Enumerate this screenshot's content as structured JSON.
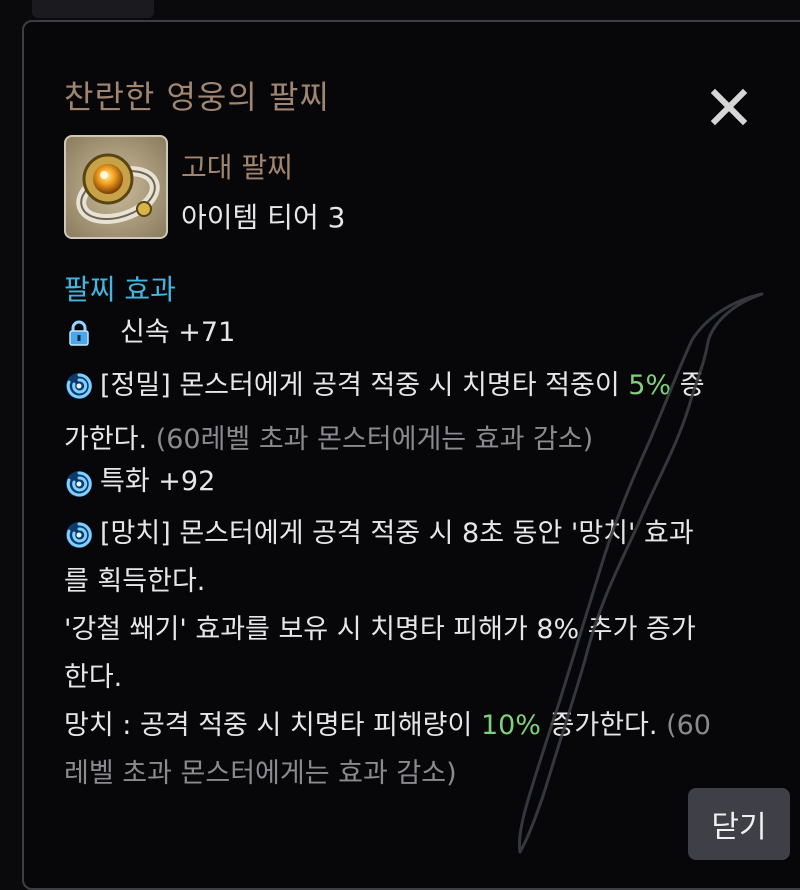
{
  "dialog": {
    "title": "찬란한 영웅의 팔찌",
    "close_icon": "close-icon",
    "close_button_label": "닫기"
  },
  "item": {
    "icon": "bracelet-icon",
    "grade": "고대 팔찌",
    "tier": "아이템 티어 3"
  },
  "effects": {
    "section_title": "팔찌 효과",
    "stat1": {
      "icon": "lock-icon",
      "text": "신속 +71"
    },
    "effect1": {
      "icon": "swirl-icon",
      "part1": "[정밀] 몬스터에게 공격 적중 시 치명타 적중이 ",
      "value": "5%",
      "part2": " 증",
      "line2": "가한다.",
      "note": " (60레벨 초과 몬스터에게는 효과 감소)"
    },
    "stat2": {
      "icon": "swirl-icon",
      "text": "특화 +92"
    },
    "effect2": {
      "icon": "swirl-icon",
      "line1": "[망치] 몬스터에게 공격 적중 시 8초 동안 '망치' 효과",
      "line2": "를 획득한다.",
      "line3": "'강철 쐐기' 효과를 보유 시 치명타 피해가 8% 추가 증가",
      "line4": "한다.",
      "line5_part1": "망치 : 공격 적중 시 치명타 피해량이 ",
      "line5_value": "10%",
      "line5_part2": " 증가한다.",
      "line5_note": " (60",
      "line6": "레벨 초과 몬스터에게는 효과 감소)"
    }
  },
  "colors": {
    "title": "#a08670",
    "section": "#42b6e0",
    "highlight": "#7ed07a",
    "muted": "#8a8a8f"
  }
}
